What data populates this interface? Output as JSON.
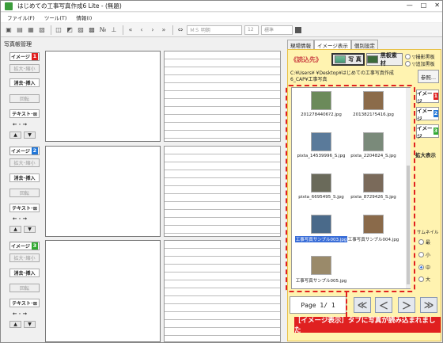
{
  "window": {
    "title": "はじめての工事写真作成6 Lite - (無題)",
    "min": "—",
    "max": "□",
    "close": "✕"
  },
  "menu": [
    "ファイル(F)",
    "ツール(T)",
    "情報(I)"
  ],
  "toolbar": {
    "font": "ＭＳ 明朝",
    "size": "12",
    "style": "標準"
  },
  "left": {
    "header": "写真帳管理",
    "blocks": [
      {
        "image_label": "イメージ",
        "num": "1",
        "btn_zoom": "拡大･縮小",
        "btn_remove": "消去･挿入",
        "btn_rotate": "回転",
        "btn_text": "テキスト･⊠",
        "arrows": "← · →",
        "up": "▲",
        "down": "▼"
      },
      {
        "image_label": "イメージ",
        "num": "2",
        "btn_zoom": "拡大･縮小",
        "btn_remove": "消去･挿入",
        "btn_rotate": "回転",
        "btn_text": "テキスト･⊠",
        "arrows": "← · →",
        "up": "▲",
        "down": "▼"
      },
      {
        "image_label": "イメージ",
        "num": "3",
        "btn_zoom": "拡大･縮小",
        "btn_remove": "消去･挿入",
        "btn_rotate": "回転",
        "btn_text": "テキスト･⊠",
        "arrows": "← · →",
        "up": "▲",
        "down": "▼"
      }
    ]
  },
  "right": {
    "tabs": [
      "現場情報",
      "イメージ表示",
      "個別設定"
    ],
    "load_label": "《読込先》",
    "photo_btn": "写 真",
    "board_btn": "黒板素材",
    "radio_board": [
      "▽撮影黒板",
      "▽追加黒板"
    ],
    "path": "C:¥Users¥           ¥Desktop¥はじめての工事写真作成6_CAP¥工事写真",
    "browse": "参照...",
    "thumbs": [
      {
        "name": "2012784406?2.jpg",
        "color": "#6b8a5a"
      },
      {
        "name": "2013821?5416.jpg",
        "color": "#8b6b4a"
      },
      {
        "name": "pixta_14539996_S.jpg",
        "color": "#5a7a9a"
      },
      {
        "name": "pixta_2204824_S.jpg",
        "color": "#7a8a7a"
      },
      {
        "name": "pixta_6695495_S.jpg",
        "color": "#6a6a5a"
      },
      {
        "name": "pixta_8729426_S.jpg",
        "color": "#7a6a5a"
      },
      {
        "name": "工事写真サンプル003.jpg",
        "color": "#4a6a8a"
      },
      {
        "name": "工事写真サンプル004.jpg",
        "color": "#8a6a4a"
      },
      {
        "name": "工事写真サンプル005.jpg",
        "color": "#9a8a6a"
      }
    ],
    "side": [
      {
        "label": "イメージ",
        "num": "1"
      },
      {
        "label": "イメージ",
        "num": "2"
      },
      {
        "label": "イメージ",
        "num": "3"
      }
    ],
    "zoom_view": "拡大表示",
    "size_label": "サムネイル",
    "sizes": [
      "最",
      "小",
      "中",
      "大"
    ],
    "page": "Page 1/ 1",
    "nav": [
      "≪",
      "＜",
      "＞",
      "≫"
    ]
  },
  "caption": "［イメージ表示］タブに写真が読み込まれました"
}
